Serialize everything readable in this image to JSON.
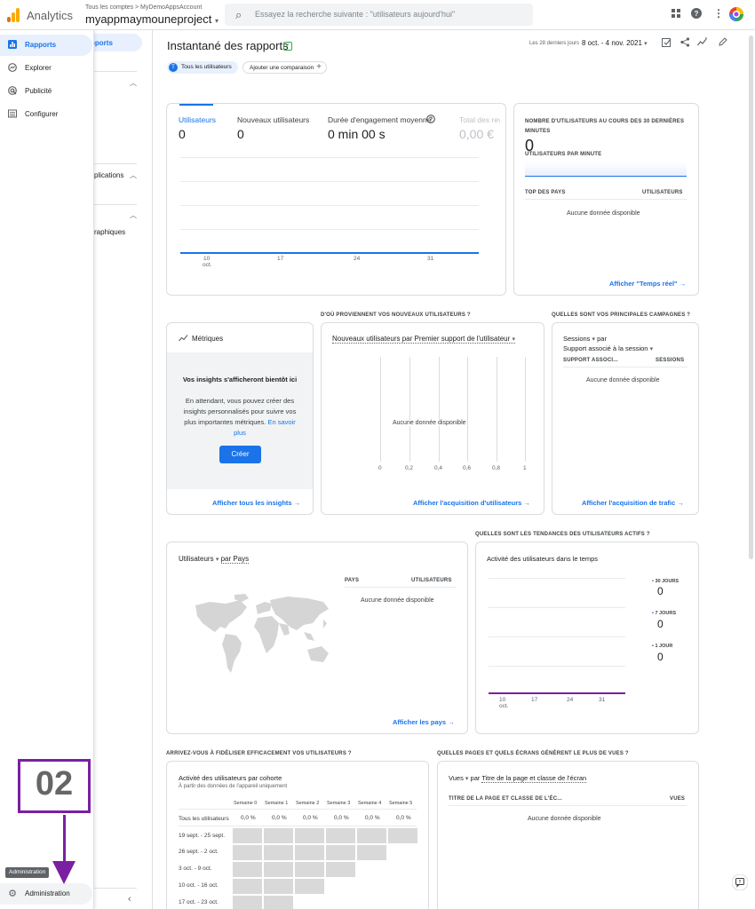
{
  "topbar": {
    "brand": "Analytics",
    "account_path": "Tous les comptes > MyDemoAppsAccount",
    "property": "myappmaymouneproject",
    "search_placeholder": "Essayez la recherche suivante : \"utilisateurs aujourd'hui\""
  },
  "rail": {
    "items": [
      {
        "label": "Rapports",
        "icon": "bar-chart-icon",
        "active": true
      },
      {
        "label": "Explorer",
        "icon": "explore-icon"
      },
      {
        "label": "Publicité",
        "icon": "ads-icon"
      },
      {
        "label": "Configurer",
        "icon": "list-icon"
      }
    ],
    "admin_label": "Administration",
    "admin_tooltip": "Administration"
  },
  "subnav": {
    "active_fragment": "pports",
    "apps_fragment": "plications",
    "demo_fragment": "raphiques"
  },
  "header": {
    "title": "Instantané des rapports",
    "chip_all": "Tous les utilisateurs",
    "chip_all_initial": "T",
    "chip_compare": "Ajouter une comparaison",
    "date_label": "Les 28 derniers jours",
    "date_value": "8 oct. - 4 nov. 2021"
  },
  "overview": {
    "metrics": [
      {
        "label": "Utilisateurs",
        "value": "0",
        "active": true
      },
      {
        "label": "Nouveaux utilisateurs",
        "value": "0"
      },
      {
        "label": "Durée d'engagement moyenne",
        "value": "0 min 00 s"
      },
      {
        "label": "Total des reve",
        "value": "0,00 €"
      }
    ],
    "x_ticks": [
      "10",
      "17",
      "24",
      "31"
    ],
    "x_month": "oct."
  },
  "realtime": {
    "title": "NOMBRE D'UTILISATEURS AU COURS DES 30 DERNIÈRES MINUTES",
    "value": "0",
    "per_minute": "UTILISATEURS PAR MINUTE",
    "col_country": "TOP DES PAYS",
    "col_users": "UTILISATEURS",
    "nodata": "Aucune donnée disponible",
    "link": "Afficher \"Temps réel\""
  },
  "insights": {
    "title": "Métriques",
    "heading": "Vos insights s'afficheront bientôt ici",
    "body": "En attendant, vous pouvez créer des insights personnalisés pour suivre vos plus importantes métriques.",
    "learn_more": "En savoir plus",
    "create": "Créer",
    "link": "Afficher tous les insights"
  },
  "acquisition": {
    "section": "D'OÙ PROVIENNENT VOS NOUVEAUX UTILISATEURS ?",
    "dropdown": "Nouveaux utilisateurs par Premier support de l'utilisateur",
    "nodata": "Aucune donnée disponible",
    "x_ticks": [
      "0",
      "0,2",
      "0,4",
      "0,6",
      "0,8",
      "1"
    ],
    "link": "Afficher l'acquisition d'utilisateurs"
  },
  "campaigns": {
    "section": "QUELLES SONT VOS PRINCIPALES CAMPAGNES ?",
    "dropdown1": "Sessions",
    "by": "par",
    "dropdown2": "Support associé à la session",
    "col1": "SUPPORT ASSOCI...",
    "col2": "SESSIONS",
    "nodata": "Aucune donnée disponible",
    "link": "Afficher l'acquisition de trafic"
  },
  "countries": {
    "dropdown": "Utilisateurs",
    "by": "par Pays",
    "col1": "PAYS",
    "col2": "UTILISATEURS",
    "nodata": "Aucune donnée disponible",
    "link": "Afficher les pays"
  },
  "active_users": {
    "section": "QUELLES SONT LES TENDANCES DES UTILISATEURS ACTIFS ?",
    "title": "Activité des utilisateurs dans le temps",
    "legend": [
      {
        "label": "30 JOURS",
        "value": "0",
        "color": "#5f6368"
      },
      {
        "label": "7 JOURS",
        "value": "0",
        "color": "#3f51b5"
      },
      {
        "label": "1 JOUR",
        "value": "0",
        "color": "#7b1fa2"
      }
    ],
    "x_ticks": [
      "10",
      "17",
      "24",
      "31"
    ],
    "x_month": "oct."
  },
  "retention": {
    "section": "ARRIVEZ-VOUS À FIDÉLISER EFFICACEMENT VOS UTILISATEURS ?",
    "title": "Activité des utilisateurs par cohorte",
    "subtitle": "À partir des données de l'appareil uniquement",
    "weeks": [
      "Semaine 0",
      "Semaine 1",
      "Semaine 2",
      "Semaine 3",
      "Semaine 4",
      "Semaine 5"
    ],
    "all_label": "Tous les utilisateurs",
    "all_values": [
      "0,0 %",
      "0,0 %",
      "0,0 %",
      "0,0 %",
      "0,0 %",
      "0,0 %"
    ],
    "rows": [
      "19 sept. - 25 sept.",
      "26 sept. - 2 oct.",
      "3 oct. - 9 oct.",
      "10 oct. - 16 oct.",
      "17 oct. - 23 oct."
    ]
  },
  "pages": {
    "section": "QUELLES PAGES ET QUELS ÉCRANS GÉNÈRENT LE PLUS DE VUES ?",
    "dropdown1": "Vues",
    "by": "par",
    "dropdown2": "Titre de la page et classe de l'écran",
    "col1": "TITRE DE LA PAGE ET CLASSE DE L'ÉC...",
    "col2": "VUES",
    "nodata": "Aucune donnée disponible"
  },
  "annotation": {
    "step": "02",
    "color": "#7b1fa2"
  }
}
